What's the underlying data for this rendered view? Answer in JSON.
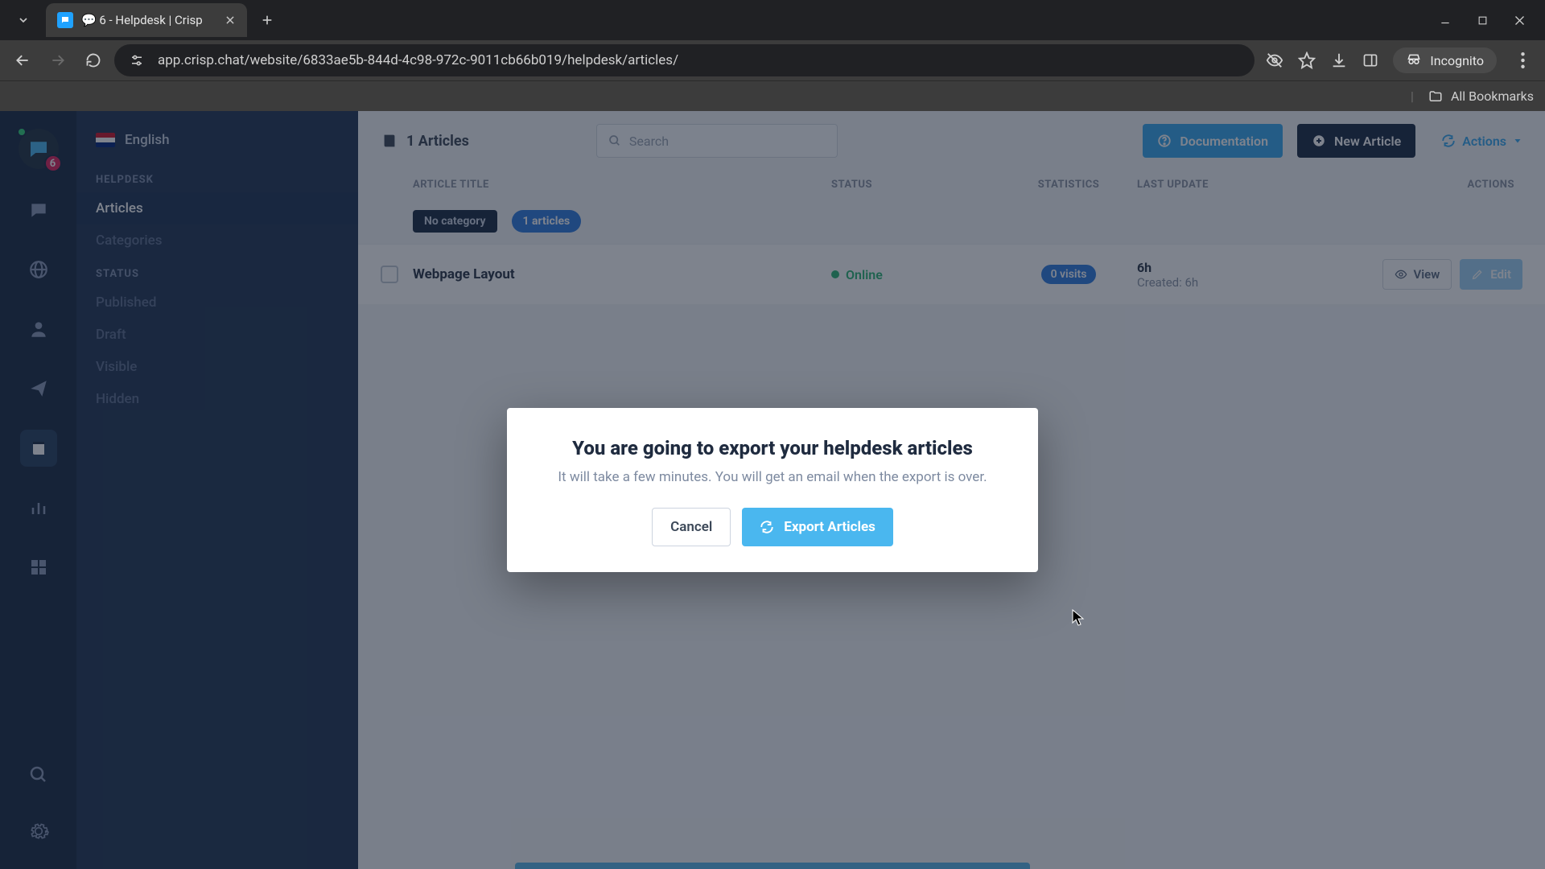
{
  "browser": {
    "tab_title": "6 - Helpdesk | Crisp",
    "url": "app.crisp.chat/website/6833ae5b-844d-4c98-972c-9011cb66b019/helpdesk/articles/",
    "incognito_label": "Incognito",
    "all_bookmarks": "All Bookmarks"
  },
  "rail": {
    "badge_count": "6"
  },
  "sidebar": {
    "language": "English",
    "heading_helpdesk": "HELPDESK",
    "link_articles": "Articles",
    "link_categories": "Categories",
    "heading_status": "STATUS",
    "status_published": "Published",
    "status_draft": "Draft",
    "status_visible": "Visible",
    "status_hidden": "Hidden"
  },
  "toolbar": {
    "articles_count": "1 Articles",
    "search_placeholder": "Search",
    "doc_label": "Documentation",
    "new_label": "New Article",
    "actions_label": "Actions"
  },
  "thead": {
    "title": "ARTICLE TITLE",
    "status": "STATUS",
    "stats": "STATISTICS",
    "update": "LAST UPDATE",
    "actions": "ACTIONS"
  },
  "group": {
    "nocat": "No category",
    "count": "1 articles"
  },
  "row0": {
    "title": "Webpage Layout",
    "status": "Online",
    "visits": "0 visits",
    "age": "6h",
    "created": "Created: 6h",
    "view": "View",
    "edit": "Edit"
  },
  "modal": {
    "title": "You are going to export your helpdesk articles",
    "subtitle": "It will take a few minutes. You will get an email when the export is over.",
    "cancel": "Cancel",
    "export": "Export Articles"
  }
}
